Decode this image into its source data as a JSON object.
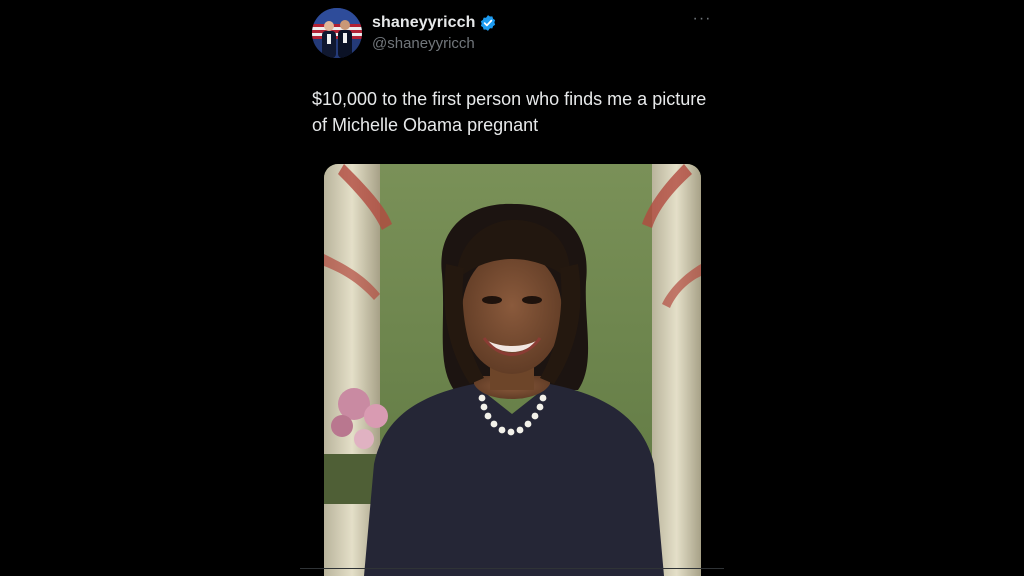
{
  "tweet": {
    "display_name": "shaneyyricch",
    "handle": "@shaneyyricch",
    "verified": true,
    "more_menu_label": "···",
    "text": "$10,000 to the first person who finds me a picture of Michelle Obama pregnant",
    "media": {
      "subject": "portrait photo of a woman with dark bob hairstyle and bangs, wearing a dark navy dress and pearl necklace, green backdrop with curtains and flowers"
    }
  },
  "colors": {
    "background": "#000000",
    "primary_text": "#e7e9ea",
    "secondary_text": "#71767b",
    "verified_blue": "#1d9bf0",
    "photo_backdrop": "#6f8a4e"
  }
}
